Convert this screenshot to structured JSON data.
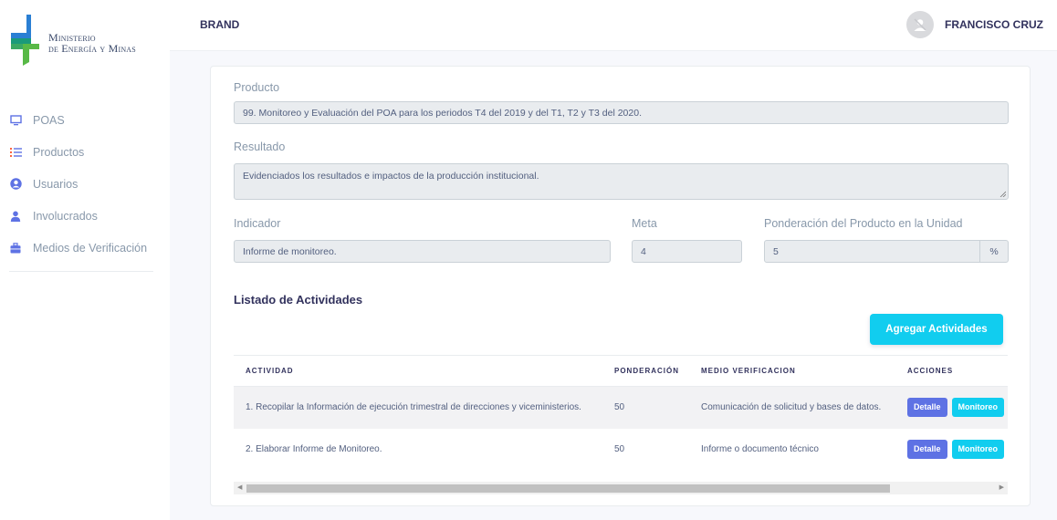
{
  "sidebar": {
    "logo_line1": "Ministerio",
    "logo_line2": "de Energía y Minas",
    "items": [
      {
        "label": "POAS",
        "icon": "monitor-icon",
        "color": "#5e72e4"
      },
      {
        "label": "Productos",
        "icon": "list-icon",
        "color": "#5e72e4"
      },
      {
        "label": "Usuarios",
        "icon": "user-circle-icon",
        "color": "#5e72e4"
      },
      {
        "label": "Involucrados",
        "icon": "user-icon",
        "color": "#5e72e4"
      },
      {
        "label": "Medios de Verificación",
        "icon": "briefcase-icon",
        "color": "#5e72e4"
      }
    ]
  },
  "topbar": {
    "brand": "BRAND",
    "user_name": "FRANCISCO CRUZ"
  },
  "form": {
    "producto_label": "Producto",
    "producto_value": "99. Monitoreo y Evaluación del POA para los periodos T4 del 2019 y del T1, T2 y T3 del 2020.",
    "resultado_label": "Resultado",
    "resultado_value": "Evidenciados los resultados e impactos de la producción institucional.",
    "indicador_label": "Indicador",
    "indicador_value": "Informe de monitoreo.",
    "meta_label": "Meta",
    "meta_value": "4",
    "ponderacion_label": "Ponderación del Producto en la Unidad",
    "ponderacion_value": "5",
    "ponderacion_unit": "%"
  },
  "actividades": {
    "title": "Listado de Actividades",
    "add_button": "Agregar Actividades",
    "columns": [
      "ACTIVIDAD",
      "PONDERACIÓN",
      "MEDIO VERIFICACION",
      "ACCIONES"
    ],
    "rows": [
      {
        "actividad": "1. Recopilar la Información de ejecución trimestral de direcciones y viceministerios.",
        "ponderacion": "50",
        "medio": "Comunicación de solicitud y bases de datos.",
        "detalle": "Detalle",
        "monitoreo": "Monitoreo"
      },
      {
        "actividad": "2. Elaborar Informe de Monitoreo.",
        "ponderacion": "50",
        "medio": "Informe o documento técnico",
        "detalle": "Detalle",
        "monitoreo": "Monitoreo"
      }
    ]
  },
  "colors": {
    "primary": "#5e72e4",
    "info": "#11cdef",
    "logo_blue": "#2a7fd4",
    "logo_green": "#58b947"
  }
}
